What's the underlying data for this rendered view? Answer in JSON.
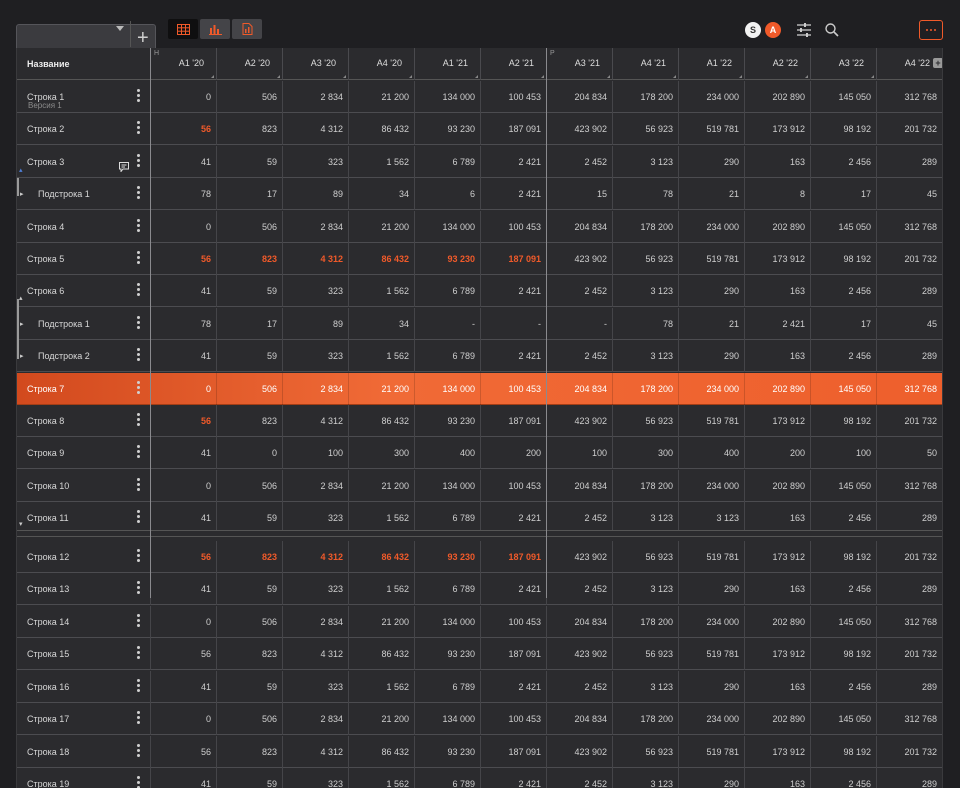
{
  "toolbar": {
    "select_value": "",
    "icons": [
      "table-icon",
      "bar-chart-icon",
      "report-icon",
      "sliders-icon",
      "search-icon",
      "more-icon"
    ],
    "avatars": [
      "S",
      "A"
    ],
    "accent": "#f05a2a"
  },
  "table": {
    "name_header": "Название",
    "columns": [
      "A1 '20",
      "A2 '20",
      "A3 '20",
      "A4 '20",
      "A1 '21",
      "A2 '21",
      "A3 '21",
      "A4 '21",
      "A1 '22",
      "A2 '22",
      "A3 '22",
      "A4 '22"
    ],
    "column_flags": {
      "0": "H",
      "6": "P"
    },
    "version_label": "Версия 1",
    "rows": [
      {
        "name": "Строка 1",
        "values": [
          "0",
          "506",
          "2 834",
          "21 200",
          "134 000",
          "100 453",
          "204 834",
          "178 200",
          "234 000",
          "202 890",
          "145 050",
          "312 768"
        ],
        "red": []
      },
      {
        "name": "Строка 2",
        "values": [
          "56",
          "823",
          "4 312",
          "86 432",
          "93 230",
          "187 091",
          "423 902",
          "56 923",
          "519 781",
          "173 912",
          "98 192",
          "201 732"
        ],
        "red": [
          0
        ]
      },
      {
        "name": "Строка 3",
        "values": [
          "41",
          "59",
          "323",
          "1 562",
          "6 789",
          "2 421",
          "2 452",
          "3 123",
          "290",
          "163",
          "2 456",
          "289"
        ],
        "red": [],
        "note": true
      },
      {
        "name": "Подстрока 1",
        "sub": true,
        "values": [
          "78",
          "17",
          "89",
          "34",
          "6",
          "2 421",
          "15",
          "78",
          "21",
          "8",
          "17",
          "45"
        ],
        "red": []
      },
      {
        "name": "Строка 4",
        "values": [
          "0",
          "506",
          "2 834",
          "21 200",
          "134 000",
          "100 453",
          "204 834",
          "178 200",
          "234 000",
          "202 890",
          "145 050",
          "312 768"
        ],
        "red": []
      },
      {
        "name": "Строка 5",
        "values": [
          "56",
          "823",
          "4 312",
          "86 432",
          "93 230",
          "187 091",
          "423 902",
          "56 923",
          "519 781",
          "173 912",
          "98 192",
          "201 732"
        ],
        "red": [
          0,
          1,
          2,
          3,
          4,
          5
        ]
      },
      {
        "name": "Строка 6",
        "values": [
          "41",
          "59",
          "323",
          "1 562",
          "6 789",
          "2 421",
          "2 452",
          "3 123",
          "290",
          "163",
          "2 456",
          "289"
        ],
        "red": []
      },
      {
        "name": "Подстрока 1",
        "sub": true,
        "values": [
          "78",
          "17",
          "89",
          "34",
          "-",
          "-",
          "-",
          "78",
          "21",
          "2 421",
          "17",
          "45"
        ],
        "red": []
      },
      {
        "name": "Подстрока 2",
        "sub": true,
        "values": [
          "41",
          "59",
          "323",
          "1 562",
          "6 789",
          "2 421",
          "2 452",
          "3 123",
          "290",
          "163",
          "2 456",
          "289"
        ],
        "red": []
      },
      {
        "name": "Строка 7",
        "highlight": true,
        "values": [
          "0",
          "506",
          "2 834",
          "21 200",
          "134 000",
          "100 453",
          "204 834",
          "178 200",
          "234 000",
          "202 890",
          "145 050",
          "312 768"
        ],
        "red": []
      },
      {
        "name": "Строка 8",
        "values": [
          "56",
          "823",
          "4 312",
          "86 432",
          "93 230",
          "187 091",
          "423 902",
          "56 923",
          "519 781",
          "173 912",
          "98 192",
          "201 732"
        ],
        "red": [
          0
        ]
      },
      {
        "name": "Строка 9",
        "values": [
          "41",
          "0",
          "100",
          "300",
          "400",
          "200",
          "100",
          "300",
          "400",
          "200",
          "100",
          "50"
        ],
        "red": []
      },
      {
        "name": "Строка 10",
        "values": [
          "0",
          "506",
          "2 834",
          "21 200",
          "134 000",
          "100 453",
          "204 834",
          "178 200",
          "234 000",
          "202 890",
          "145 050",
          "312 768"
        ],
        "red": []
      },
      {
        "name": "Строка 11",
        "values": [
          "41",
          "59",
          "323",
          "1 562",
          "6 789",
          "2 421",
          "2 452",
          "3 123",
          "3 123",
          "163",
          "2 456",
          "289"
        ],
        "red": []
      },
      {
        "name": "Строка 12",
        "values": [
          "56",
          "823",
          "4 312",
          "86 432",
          "93 230",
          "187 091",
          "423 902",
          "56 923",
          "519 781",
          "173 912",
          "98 192",
          "201 732"
        ],
        "red": [
          0,
          1,
          2,
          3,
          4,
          5
        ]
      },
      {
        "name": "Строка 13",
        "values": [
          "41",
          "59",
          "323",
          "1 562",
          "6 789",
          "2 421",
          "2 452",
          "3 123",
          "290",
          "163",
          "2 456",
          "289"
        ],
        "red": []
      },
      {
        "name": "Строка 14",
        "values": [
          "0",
          "506",
          "2 834",
          "21 200",
          "134 000",
          "100 453",
          "204 834",
          "178 200",
          "234 000",
          "202 890",
          "145 050",
          "312 768"
        ],
        "red": []
      },
      {
        "name": "Строка 15",
        "values": [
          "56",
          "823",
          "4 312",
          "86 432",
          "93 230",
          "187 091",
          "423 902",
          "56 923",
          "519 781",
          "173 912",
          "98 192",
          "201 732"
        ],
        "red": []
      },
      {
        "name": "Строка 16",
        "values": [
          "41",
          "59",
          "323",
          "1 562",
          "6 789",
          "2 421",
          "2 452",
          "3 123",
          "290",
          "163",
          "2 456",
          "289"
        ],
        "red": []
      },
      {
        "name": "Строка 17",
        "values": [
          "0",
          "506",
          "2 834",
          "21 200",
          "134 000",
          "100 453",
          "204 834",
          "178 200",
          "234 000",
          "202 890",
          "145 050",
          "312 768"
        ],
        "red": []
      },
      {
        "name": "Строка 18",
        "values": [
          "56",
          "823",
          "4 312",
          "86 432",
          "93 230",
          "187 091",
          "423 902",
          "56 923",
          "519 781",
          "173 912",
          "98 192",
          "201 732"
        ],
        "red": []
      },
      {
        "name": "Строка 19",
        "values": [
          "41",
          "59",
          "323",
          "1 562",
          "6 789",
          "2 421",
          "2 452",
          "3 123",
          "290",
          "163",
          "2 456",
          "289"
        ],
        "red": []
      }
    ]
  }
}
